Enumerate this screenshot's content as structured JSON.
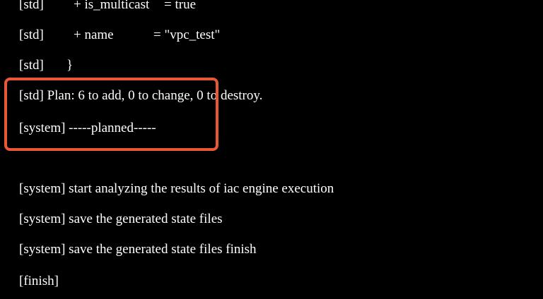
{
  "log": {
    "lines": [
      {
        "prefix": "[std]",
        "key": "+ is_multicast",
        "value": "= true"
      },
      {
        "prefix": "[std]",
        "key": "+ name",
        "value": "= \"vpc_test\""
      },
      {
        "prefix": "[std]",
        "key": "}"
      },
      {
        "text": "[std] Plan: 6 to add, 0 to change, 0 to destroy."
      },
      {
        "text": "[system] -----planned-----"
      },
      {
        "text": "[system] start analyzing the results of iac engine execution"
      },
      {
        "text": "[system] save the generated state files"
      },
      {
        "text": "[system] save the generated state files finish"
      },
      {
        "text": "[finish]"
      }
    ]
  },
  "highlight": {
    "color": "#e8573a"
  }
}
